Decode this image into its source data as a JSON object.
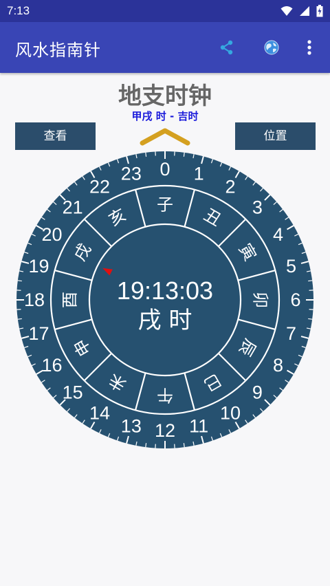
{
  "status": {
    "time": "7:13"
  },
  "appbar": {
    "title": "风水指南针"
  },
  "page": {
    "title": "地支时钟",
    "subtitle": "甲戌 时 - 吉时",
    "view_button": "查看",
    "location_button": "位置"
  },
  "clock": {
    "time": "19:13:03",
    "branch_hour": "戌 时",
    "hours": [
      "0",
      "1",
      "2",
      "3",
      "4",
      "5",
      "6",
      "7",
      "8",
      "9",
      "10",
      "11",
      "12",
      "13",
      "14",
      "15",
      "16",
      "17",
      "18",
      "19",
      "20",
      "21",
      "22",
      "23"
    ],
    "branches": [
      "子",
      "丑",
      "寅",
      "卯",
      "辰",
      "巳",
      "午",
      "未",
      "申",
      "酉",
      "戌",
      "亥"
    ]
  },
  "colors": {
    "dial": "#265170",
    "statusbar": "#2b3399",
    "appbar": "#3945b5",
    "pointer": "#d4a020",
    "marker": "#e01010"
  },
  "icons": [
    "wifi-icon",
    "signal-icon",
    "battery-icon",
    "share-icon",
    "globe-icon",
    "more-vert-icon"
  ]
}
